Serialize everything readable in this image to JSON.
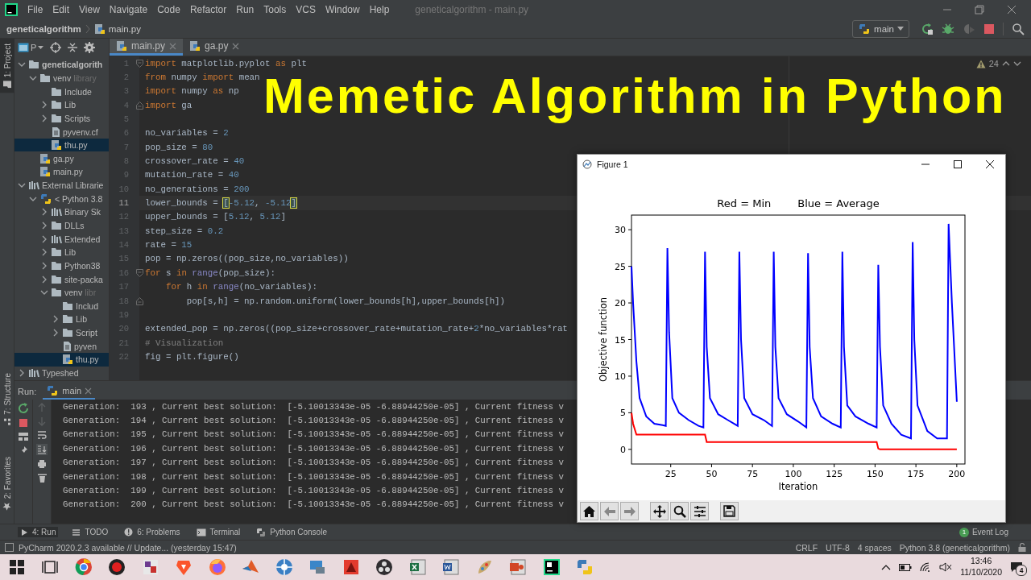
{
  "menu_bar": {
    "items": [
      "File",
      "Edit",
      "View",
      "Navigate",
      "Code",
      "Refactor",
      "Run",
      "Tools",
      "VCS",
      "Window",
      "Help"
    ],
    "window_title": "geneticalgorithm - main.py"
  },
  "nav_bar": {
    "project": "geneticalgorithm",
    "file": "main.py",
    "run_config": "main"
  },
  "side_stripe": {
    "top": [
      {
        "label": "1: Project",
        "selected": true
      }
    ],
    "bottom": [
      {
        "label": "7: Structure",
        "kind": "structure"
      },
      {
        "label": "2: Favorites",
        "kind": "favorites"
      }
    ]
  },
  "project_view": {
    "label": "P",
    "tree": [
      {
        "label": "geneticalgorith",
        "kind": "folder",
        "expanded": true,
        "selected": false,
        "children": [
          {
            "label": "venv",
            "hint": "library",
            "kind": "folder",
            "expanded": true,
            "selected": false,
            "children": [
              {
                "label": "Include",
                "kind": "folder",
                "selected": false
              },
              {
                "label": "Lib",
                "kind": "folder",
                "expanded": false,
                "selected": false
              },
              {
                "label": "Scripts",
                "kind": "folder",
                "expanded": false,
                "selected": false
              },
              {
                "label": "pyvenv.cf",
                "kind": "file",
                "selected": false
              },
              {
                "label": "thu.py",
                "kind": "pyfile",
                "selected": true
              }
            ]
          },
          {
            "label": "ga.py",
            "kind": "pyfile",
            "selected": false
          },
          {
            "label": "main.py",
            "kind": "pyfile",
            "selected": false
          }
        ]
      },
      {
        "label": "External Librarie",
        "kind": "library",
        "expanded": true,
        "selected": false,
        "children": [
          {
            "label": "< Python 3.8",
            "kind": "python",
            "expanded": true,
            "selected": false,
            "children": [
              {
                "label": "Binary Sk",
                "kind": "library",
                "expanded": false,
                "selected": false
              },
              {
                "label": "DLLs",
                "kind": "folder",
                "expanded": false,
                "selected": false
              },
              {
                "label": "Extended",
                "kind": "library",
                "expanded": false,
                "selected": false
              },
              {
                "label": "Lib",
                "kind": "folder",
                "expanded": false,
                "selected": false
              },
              {
                "label": "Python38",
                "kind": "folder",
                "expanded": false,
                "selected": false
              },
              {
                "label": "site-packa",
                "kind": "folder",
                "expanded": false,
                "selected": false
              },
              {
                "label": "venv",
                "hint": "libr",
                "kind": "folder",
                "expanded": true,
                "selected": false,
                "children": [
                  {
                    "label": "Includ",
                    "kind": "folder",
                    "selected": false
                  },
                  {
                    "label": "Lib",
                    "kind": "folder",
                    "expanded": false,
                    "selected": false
                  },
                  {
                    "label": "Script",
                    "kind": "folder",
                    "expanded": false,
                    "selected": false
                  },
                  {
                    "label": "pyven",
                    "kind": "file",
                    "selected": false
                  },
                  {
                    "label": "thu.py",
                    "kind": "pyfile",
                    "selected": true
                  }
                ]
              }
            ]
          }
        ]
      },
      {
        "label": "Typeshed",
        "kind": "library",
        "expanded": false,
        "selected": false
      }
    ]
  },
  "editor": {
    "tabs": [
      {
        "label": "main.py",
        "selected": true
      },
      {
        "label": "ga.py",
        "selected": false
      }
    ],
    "warnings": "24",
    "lines": [
      {
        "number": "1",
        "current": false,
        "fold_start": true,
        "fold_end": false,
        "segments": [
          {
            "kind": "keyword",
            "text": "import"
          },
          {
            "kind": "plain",
            "text": " matplotlib.pyplot "
          },
          {
            "kind": "keyword",
            "text": "as"
          },
          {
            "kind": "plain",
            "text": " plt"
          }
        ]
      },
      {
        "number": "2",
        "current": false,
        "fold_start": false,
        "fold_end": false,
        "segments": [
          {
            "kind": "keyword",
            "text": "from"
          },
          {
            "kind": "plain",
            "text": " numpy "
          },
          {
            "kind": "keyword",
            "text": "import"
          },
          {
            "kind": "plain",
            "text": " mean"
          }
        ]
      },
      {
        "number": "3",
        "current": false,
        "fold_start": false,
        "fold_end": false,
        "segments": [
          {
            "kind": "keyword",
            "text": "import"
          },
          {
            "kind": "plain",
            "text": " numpy "
          },
          {
            "kind": "keyword",
            "text": "as"
          },
          {
            "kind": "plain",
            "text": " np"
          }
        ]
      },
      {
        "number": "4",
        "current": false,
        "fold_start": false,
        "fold_end": true,
        "segments": [
          {
            "kind": "keyword",
            "text": "import"
          },
          {
            "kind": "plain",
            "text": " ga"
          }
        ]
      },
      {
        "number": "5",
        "current": false,
        "fold_start": false,
        "fold_end": false
      },
      {
        "number": "6",
        "current": false,
        "fold_start": false,
        "fold_end": false,
        "segments": [
          {
            "kind": "plain",
            "text": "no_variables = "
          },
          {
            "kind": "number",
            "text": "2"
          }
        ]
      },
      {
        "number": "7",
        "current": false,
        "fold_start": false,
        "fold_end": false,
        "segments": [
          {
            "kind": "plain",
            "text": "pop_size = "
          },
          {
            "kind": "number",
            "text": "80"
          }
        ]
      },
      {
        "number": "8",
        "current": false,
        "fold_start": false,
        "fold_end": false,
        "segments": [
          {
            "kind": "plain",
            "text": "crossover_rate = "
          },
          {
            "kind": "number",
            "text": "40"
          }
        ]
      },
      {
        "number": "9",
        "current": false,
        "fold_start": false,
        "fold_end": false,
        "segments": [
          {
            "kind": "plain",
            "text": "mutation_rate = "
          },
          {
            "kind": "number",
            "text": "40"
          }
        ]
      },
      {
        "number": "10",
        "current": false,
        "fold_start": false,
        "fold_end": false,
        "segments": [
          {
            "kind": "plain",
            "text": "no_generations = "
          },
          {
            "kind": "number",
            "text": "200"
          }
        ]
      },
      {
        "number": "11",
        "current": true,
        "fold_start": false,
        "fold_end": false,
        "segments": [
          {
            "kind": "plain",
            "text": "lower_bounds = "
          },
          {
            "kind": "match",
            "text": "["
          },
          {
            "kind": "number",
            "text": "-5.12"
          },
          {
            "kind": "plain",
            "text": ", "
          },
          {
            "kind": "number",
            "text": "-5.12"
          },
          {
            "kind": "match",
            "text": "]"
          }
        ]
      },
      {
        "number": "12",
        "current": false,
        "fold_start": false,
        "fold_end": false,
        "segments": [
          {
            "kind": "plain",
            "text": "upper_bounds = ["
          },
          {
            "kind": "number",
            "text": "5.12"
          },
          {
            "kind": "plain",
            "text": ", "
          },
          {
            "kind": "number",
            "text": "5.12"
          },
          {
            "kind": "plain",
            "text": "]"
          }
        ]
      },
      {
        "number": "13",
        "current": false,
        "fold_start": false,
        "fold_end": false,
        "segments": [
          {
            "kind": "plain",
            "text": "step_size = "
          },
          {
            "kind": "number",
            "text": "0.2"
          }
        ]
      },
      {
        "number": "14",
        "current": false,
        "fold_start": false,
        "fold_end": false,
        "segments": [
          {
            "kind": "plain",
            "text": "rate = "
          },
          {
            "kind": "number",
            "text": "15"
          }
        ]
      },
      {
        "number": "15",
        "current": false,
        "fold_start": false,
        "fold_end": false,
        "segments": [
          {
            "kind": "plain",
            "text": "pop = np.zeros((pop_size,no_variables))"
          }
        ]
      },
      {
        "number": "16",
        "current": false,
        "fold_start": true,
        "fold_end": false,
        "segments": [
          {
            "kind": "keyword",
            "text": "for"
          },
          {
            "kind": "plain",
            "text": " s "
          },
          {
            "kind": "keyword",
            "text": "in "
          },
          {
            "kind": "builtin",
            "text": "range"
          },
          {
            "kind": "plain",
            "text": "(pop_size):"
          }
        ]
      },
      {
        "number": "17",
        "current": false,
        "fold_start": false,
        "fold_end": false,
        "segments": [
          {
            "kind": "keyword",
            "text": "    for"
          },
          {
            "kind": "plain",
            "text": " h "
          },
          {
            "kind": "keyword",
            "text": "in "
          },
          {
            "kind": "builtin",
            "text": "range"
          },
          {
            "kind": "plain",
            "text": "(no_variables):"
          }
        ]
      },
      {
        "number": "18",
        "current": false,
        "fold_start": false,
        "fold_end": true,
        "segments": [
          {
            "kind": "plain",
            "text": "        pop[s,h] = np.random.uniform(lower_bounds[h],upper_bounds[h])"
          }
        ]
      },
      {
        "number": "19",
        "current": false,
        "fold_start": false,
        "fold_end": false
      },
      {
        "number": "20",
        "current": false,
        "fold_start": false,
        "fold_end": false,
        "segments": [
          {
            "kind": "plain",
            "text": "extended_pop = np.zeros((pop_size+crossover_rate+mutation_rate+"
          },
          {
            "kind": "number",
            "text": "2"
          },
          {
            "kind": "plain",
            "text": "*no_variables*rat"
          }
        ]
      },
      {
        "number": "21",
        "current": false,
        "fold_start": false,
        "fold_end": false,
        "segments": [
          {
            "kind": "comment",
            "text": "# Visualization"
          }
        ]
      },
      {
        "number": "22",
        "current": false,
        "fold_start": false,
        "fold_end": false,
        "segments": [
          {
            "kind": "plain",
            "text": "fig = plt.figure()"
          }
        ]
      }
    ]
  },
  "title_overlay": "Memetic Algorithm in Python",
  "run_panel": {
    "label": "Run:",
    "tab": "main",
    "output": [
      "Generation:  193 , Current best solution:  [-5.10013343e-05 -6.88944250e-05] , Current fitness v",
      "Generation:  194 , Current best solution:  [-5.10013343e-05 -6.88944250e-05] , Current fitness v",
      "Generation:  195 , Current best solution:  [-5.10013343e-05 -6.88944250e-05] , Current fitness v",
      "Generation:  196 , Current best solution:  [-5.10013343e-05 -6.88944250e-05] , Current fitness v",
      "Generation:  197 , Current best solution:  [-5.10013343e-05 -6.88944250e-05] , Current fitness v",
      "Generation:  198 , Current best solution:  [-5.10013343e-05 -6.88944250e-05] , Current fitness v",
      "Generation:  199 , Current best solution:  [-5.10013343e-05 -6.88944250e-05] , Current fitness v",
      "Generation:  200 , Current best solution:  [-5.10013343e-05 -6.88944250e-05] , Current fitness v"
    ]
  },
  "tool_tabs": [
    {
      "label": "4: Run",
      "kind": "run",
      "selected": true
    },
    {
      "label": "TODO",
      "kind": "todo",
      "selected": false
    },
    {
      "label": "6: Problems",
      "kind": "problems",
      "selected": false
    },
    {
      "label": "Terminal",
      "kind": "terminal",
      "selected": false
    },
    {
      "label": "Python Console",
      "kind": "console",
      "selected": false
    }
  ],
  "event_log": {
    "label": "Event Log",
    "count": "1"
  },
  "status_bar": {
    "message": "PyCharm 2020.2.3 available // Update... (yesterday 15:47)",
    "items": [
      "CRLF",
      "UTF-8",
      "4 spaces",
      "Python 3.8 (geneticalgorithm)"
    ]
  },
  "taskbar": {
    "time": "13:46",
    "date": "11/10/2020",
    "notifications": "4"
  },
  "figure": {
    "title": "Figure 1",
    "chart_data": {
      "type": "line",
      "title": "Red = Min        Blue = Average",
      "xlabel": "Iteration",
      "ylabel": "Objective function",
      "x": [
        1,
        2,
        4,
        6,
        10,
        15,
        20,
        22,
        23,
        24,
        26,
        30,
        36,
        42,
        45,
        46,
        47,
        49,
        54,
        60,
        66,
        67,
        68,
        70,
        75,
        82,
        87,
        88,
        89,
        91,
        96,
        103,
        108,
        109,
        110,
        112,
        117,
        124,
        129,
        130,
        131,
        133,
        138,
        146,
        151,
        152,
        153,
        155,
        160,
        166,
        172,
        173,
        174,
        176,
        182,
        188,
        194,
        195,
        197,
        200
      ],
      "series": [
        {
          "color": "#0000ff",
          "values": [
            25,
            20,
            12,
            7,
            4.5,
            3.5,
            3.3,
            3.2,
            27.5,
            16,
            7,
            5,
            4,
            3.2,
            3,
            27,
            14,
            7,
            4.8,
            4,
            3.2,
            27,
            15,
            7,
            4.8,
            4,
            3.2,
            27,
            14,
            7,
            4.8,
            3.8,
            3,
            26.8,
            14,
            7,
            4.5,
            3.5,
            3,
            27,
            14,
            6,
            4.5,
            3.5,
            3,
            25.2,
            14,
            6,
            3.5,
            2,
            1.5,
            28.3,
            15,
            6,
            2.5,
            1.5,
            1.5,
            30.8,
            20,
            6.5
          ]
        },
        {
          "color": "#ff0000",
          "values": [
            5,
            3.5,
            2,
            2,
            2,
            2,
            2,
            2,
            2,
            2,
            2,
            2,
            2,
            2,
            2,
            2,
            1,
            1,
            1,
            1,
            1,
            1,
            1,
            1,
            1,
            1,
            1,
            1,
            1,
            1,
            1,
            1,
            1,
            1,
            1,
            1,
            1,
            1,
            1,
            1,
            1,
            1,
            1,
            1,
            1,
            0.1,
            0,
            0,
            0,
            0,
            0,
            0,
            0,
            0,
            0,
            0,
            0,
            0,
            0,
            0
          ]
        }
      ],
      "xlim": [
        1,
        205
      ],
      "ylim": [
        -2,
        32
      ],
      "xticks": [
        25,
        50,
        75,
        100,
        125,
        150,
        175,
        200
      ],
      "yticks": [
        0,
        5,
        10,
        15,
        20,
        25,
        30
      ]
    }
  }
}
